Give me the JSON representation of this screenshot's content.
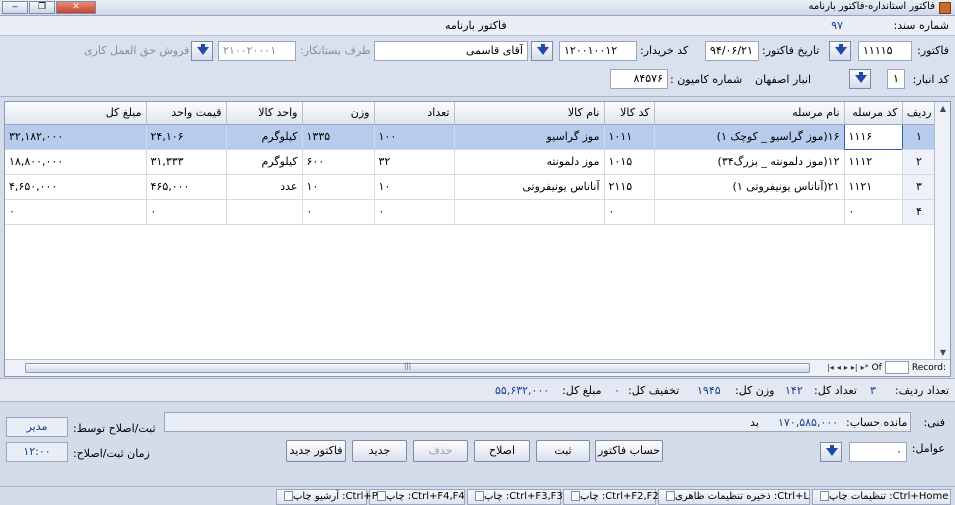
{
  "window": {
    "title": "فاکتور استانداره-فاکتور بارنامه"
  },
  "docbar": {
    "doc_number_label": "شماره سند:",
    "doc_number": "۹۷",
    "form_title": "فاکتور بارنامه"
  },
  "header": {
    "invoice_label": "فاکتور:",
    "invoice_value": "۱۱۱۱۵",
    "date_label": "تاریخ فاکتور:",
    "date_value": "۹۴/۰۶/۲۱",
    "buyer_code_label": "کد خریدار:",
    "buyer_code_value": "۱۲۰۰۱۰۰۱۲",
    "buyer_name": "آقای قاسمی",
    "counterparty_label": "طرف بستانکار:",
    "counterparty_value": "۲۱۰۰۲۰۰۰۱",
    "sale_type": "فروش حق العمل کاری",
    "warehouse_code_label": "کد انبار:",
    "warehouse_code": "۱",
    "warehouse_name": "انبار اصفهان",
    "truck_label": "شماره کامیون :",
    "truck_value": "۸۴۵۷۶"
  },
  "grid": {
    "columns": [
      "ردیف",
      "کد مرسله",
      "نام مرسله",
      "کد کالا",
      "نام کالا",
      "تعداد",
      "وزن",
      "واحد کالا",
      "قیمت واحد",
      "مبلغ کل"
    ],
    "rows": [
      [
        "۱",
        "۱۱۱۶",
        "۱۶(موز گراسیو _ کوچک ۱)",
        "۱۰۱۱",
        "موز گراسیو",
        "۱۰۰",
        "۱۳۳۵",
        "کیلوگرم",
        "۲۴,۱۰۶",
        "۳۲,۱۸۲,۰۰۰"
      ],
      [
        "۲",
        "۱۱۱۲",
        "۱۲(موز دلمونته _ بزرگ۳۴)",
        "۱۰۱۵",
        "موز دلمونته",
        "۳۲",
        "۶۰۰",
        "کیلوگرم",
        "۳۱,۳۳۳",
        "۱۸,۸۰۰,۰۰۰"
      ],
      [
        "۳",
        "۱۱۲۱",
        "۲۱(آناناس یونیفروتی ۱)",
        "۲۱۱۵",
        "آناناس یونیفروتی",
        "۱۰",
        "۱۰",
        "عدد",
        "۴۶۵,۰۰۰",
        "۴,۶۵۰,۰۰۰"
      ],
      [
        "۴",
        "۰",
        "",
        "۰",
        "",
        "۰",
        "۰",
        "",
        "۰",
        "۰"
      ]
    ],
    "nav_of": "Of",
    "nav_record": "Record:"
  },
  "totals": {
    "row_count_label": "تعداد ردیف:",
    "row_count": "۳",
    "total_qty_label": "تعداد کل:",
    "total_qty": "۱۴۲",
    "total_weight_label": "وزن کل:",
    "total_weight": "۱۹۴۵",
    "discount_label": "تخفیف کل:",
    "discount": "۰",
    "amount_label": "مبلغ کل:",
    "amount": "۵۵,۶۳۲,۰۰۰"
  },
  "footer": {
    "tech_label": "فنی:",
    "balance_label": "مانده حساب:",
    "balance": "۱۷۰,۵۸۵,۰۰۰",
    "balance_type": "بد",
    "recorded_by_label": "ثبت/اصلاح توسط:",
    "recorded_by": "مدیر",
    "record_time_label": "زمان ثبت/اصلاح:",
    "record_time": "۱۲:۰۰",
    "factors_label": "عوامل:",
    "factors_value": "۰",
    "buttons": {
      "invoice_account": "حساب فاکتور",
      "save": "ثبت",
      "edit": "اصلاح",
      "delete": "حذف",
      "new": "جدید",
      "new_invoice": "فاکتور جدید"
    }
  },
  "statusbar": {
    "print_settings": "تنظیمات چاپ :Ctrl+Home",
    "save_appearance": "ذخیره تنظیمات ظاهری :Ctrl+L",
    "print_f2": "چاپ :Ctrl+F2,F2",
    "print_f3": "چاپ :Ctrl+F3,F3",
    "print_f4": "چاپ :Ctrl+F4,F4",
    "archive_print": "آرشیو چاپ :Ctrl+P"
  }
}
